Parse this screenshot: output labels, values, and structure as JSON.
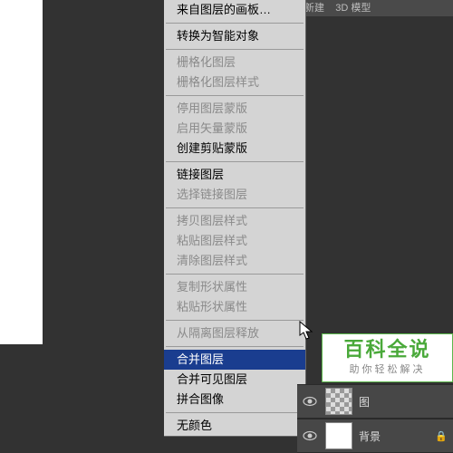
{
  "rightPanel": {
    "newBtn": "新建",
    "modelTab": "3D 模型"
  },
  "menu": {
    "items": [
      {
        "label": "来自图层的画板…",
        "enabled": true
      },
      {
        "sep": true
      },
      {
        "label": "转换为智能对象",
        "enabled": true
      },
      {
        "sep": true
      },
      {
        "label": "栅格化图层",
        "enabled": false
      },
      {
        "label": "栅格化图层样式",
        "enabled": false
      },
      {
        "sep": true
      },
      {
        "label": "停用图层蒙版",
        "enabled": false
      },
      {
        "label": "启用矢量蒙版",
        "enabled": false
      },
      {
        "label": "创建剪贴蒙版",
        "enabled": true
      },
      {
        "sep": true
      },
      {
        "label": "链接图层",
        "enabled": true
      },
      {
        "label": "选择链接图层",
        "enabled": false
      },
      {
        "sep": true
      },
      {
        "label": "拷贝图层样式",
        "enabled": false
      },
      {
        "label": "粘贴图层样式",
        "enabled": false
      },
      {
        "label": "清除图层样式",
        "enabled": false
      },
      {
        "sep": true
      },
      {
        "label": "复制形状属性",
        "enabled": false
      },
      {
        "label": "粘贴形状属性",
        "enabled": false
      },
      {
        "sep": true
      },
      {
        "label": "从隔离图层释放",
        "enabled": false
      },
      {
        "sep": true
      },
      {
        "label": "合并图层",
        "enabled": true,
        "highlighted": true
      },
      {
        "label": "合并可见图层",
        "enabled": true
      },
      {
        "label": "拼合图像",
        "enabled": true
      },
      {
        "sep": true
      },
      {
        "label": "无颜色",
        "enabled": true
      }
    ]
  },
  "layers": {
    "row1": {
      "name": "图"
    },
    "row2": {
      "name": "背景"
    }
  },
  "watermark": {
    "title": "百科全说",
    "sub": "助你轻松解决"
  }
}
